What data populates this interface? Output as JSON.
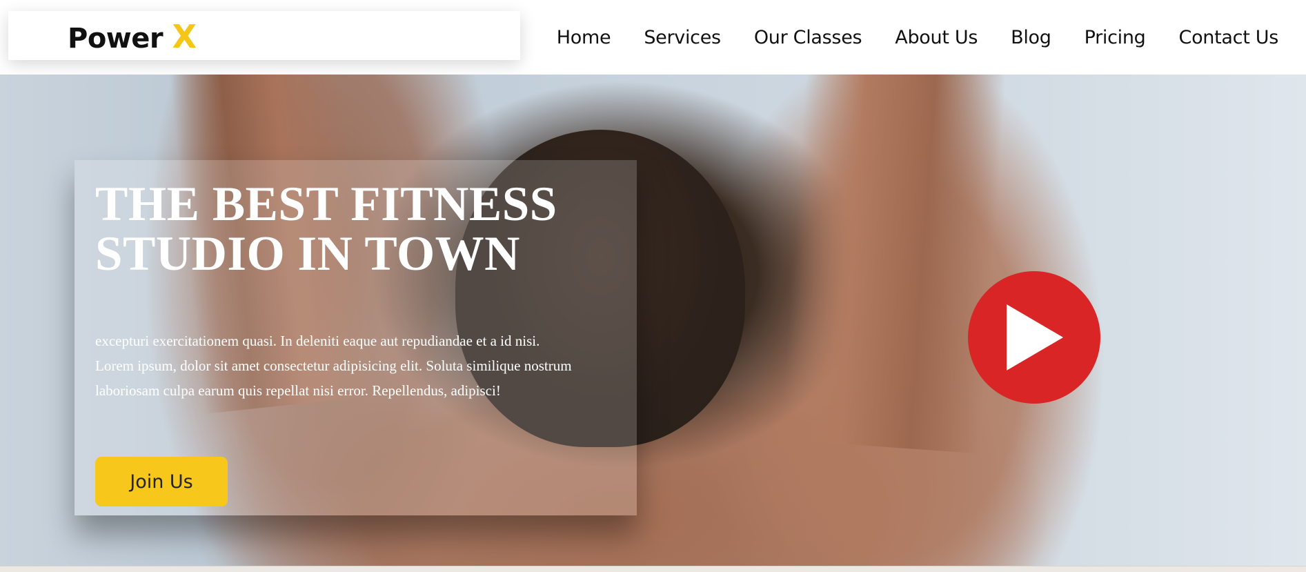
{
  "brand": {
    "name": "Power ",
    "accent": "X",
    "accent_color": "#f5c518"
  },
  "nav": {
    "items": [
      {
        "label": "Home"
      },
      {
        "label": "Services"
      },
      {
        "label": "Our Classes"
      },
      {
        "label": "About Us"
      },
      {
        "label": "Blog"
      },
      {
        "label": "Pricing"
      },
      {
        "label": "Contact Us"
      }
    ]
  },
  "hero": {
    "title_line1": "THE BEST FITNESS",
    "title_line2": "STUDIO IN TOWN",
    "text_line1": "excepturi exercitationem quasi. In deleniti eaque aut repudiandae et a id nisi.",
    "text_line2": "Lorem ipsum, dolor sit amet consectetur adipisicing elit. Soluta similique nostrum",
    "text_line3": "laboriosam culpa earum quis repellat nisi error. Repellendus, adipisci!",
    "button_label": "Join Us",
    "button_color": "#f7c81b",
    "play_icon": "play-icon",
    "play_color": "#d92525"
  }
}
